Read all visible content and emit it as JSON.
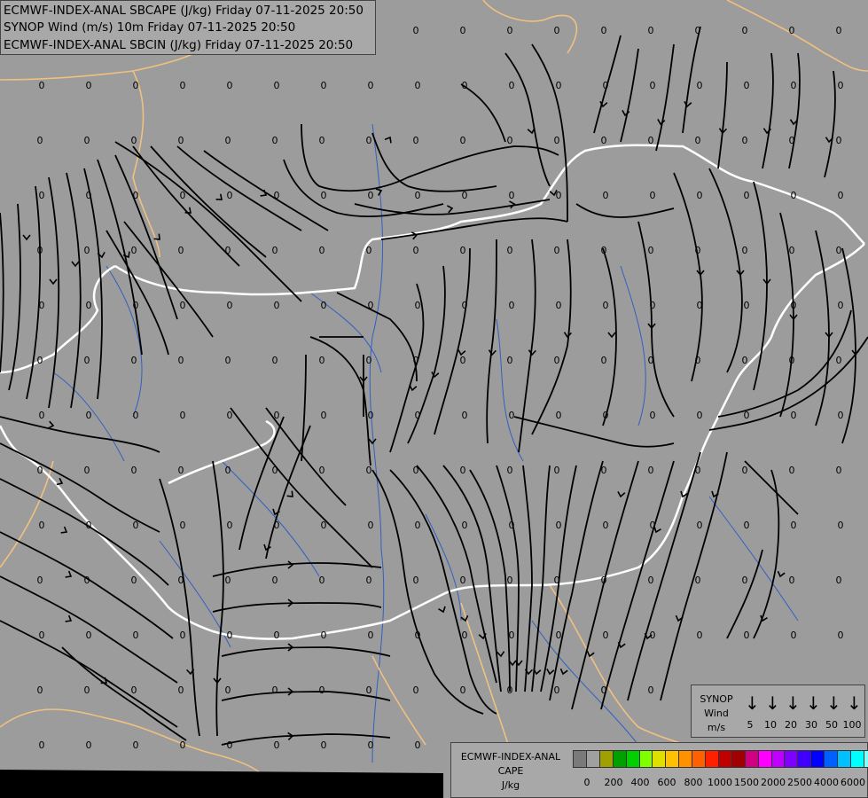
{
  "titles": {
    "line1": "ECMWF-INDEX-ANAL SBCAPE (J/kg) Friday 07-11-2025 20:50",
    "line2": "SYNOP Wind (m/s) 10m Friday 07-11-2025 20:50",
    "line3": "ECMWF-INDEX-ANAL SBCIN (J/kg) Friday 07-11-2025 20:50"
  },
  "wind_legend": {
    "title1": "SYNOP",
    "title2": "Wind",
    "unit": "m/s",
    "values": [
      "5",
      "10",
      "20",
      "30",
      "50",
      "100"
    ]
  },
  "cape_legend": {
    "title1": "ECMWF-INDEX-ANAL",
    "title2": "CAPE",
    "unit": "J/kg",
    "colors": [
      "#7a7a7a",
      "#a0a0a0",
      "#a0a000",
      "#00a000",
      "#00d000",
      "#80ff00",
      "#e0e000",
      "#ffc000",
      "#ff9000",
      "#ff6000",
      "#ff2000",
      "#c00000",
      "#a00000",
      "#d00080",
      "#ff00ff",
      "#c000ff",
      "#8000ff",
      "#4000ff",
      "#0000ff",
      "#0060ff",
      "#00c0ff",
      "#00ffff",
      "#80ffff",
      "#ffffff"
    ],
    "labels": [
      "0",
      "200",
      "400",
      "600",
      "800",
      "1000",
      "1500",
      "2000",
      "2500",
      "4000",
      "6000"
    ]
  },
  "map_value": "0",
  "colors": {
    "background": "#9c9c9c",
    "national_border": "#ffffff",
    "regional_border": "#f0c080",
    "rivers": "#3060c0",
    "streamlines": "#000000"
  }
}
